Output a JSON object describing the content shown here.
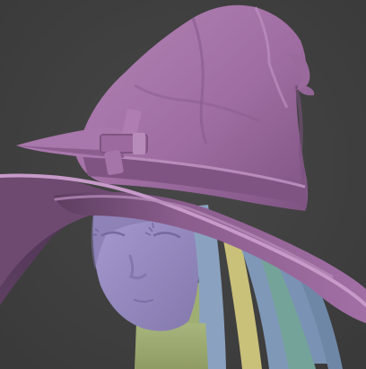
{
  "viewport": {
    "background": "#404040",
    "model": {
      "hat_color": "#a26fa4",
      "hat_shadow": "#6e4a71",
      "face_color": "#9d90c2",
      "hair_blue": "#7f98b8",
      "hair_yellow": "#c9c07a",
      "hair_teal": "#74a39a",
      "body_green": "#a8b67e"
    }
  }
}
